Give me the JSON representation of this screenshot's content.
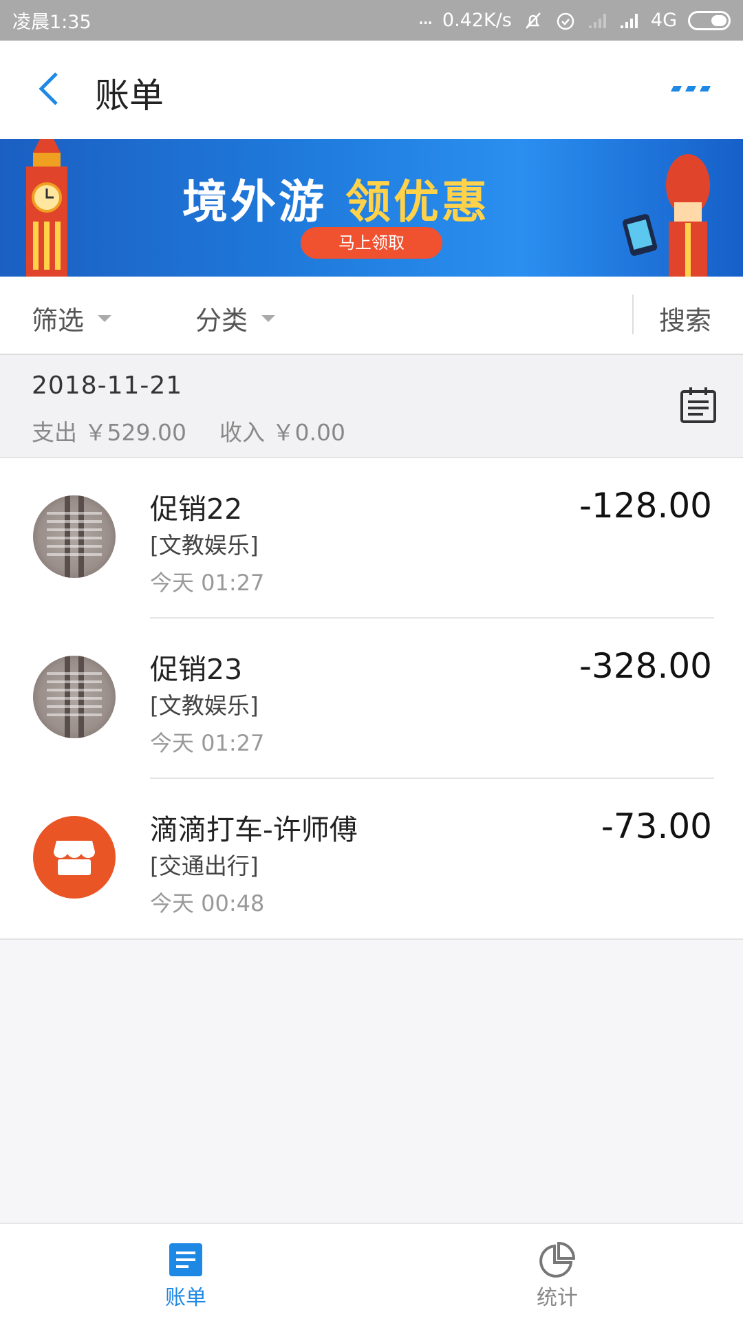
{
  "status_bar": {
    "time": "凌晨1:35",
    "dots": "...",
    "speed": "0.42K/s",
    "network": "4G"
  },
  "header": {
    "title": "账单",
    "back_icon": "chevron-left-icon",
    "more_icon": "more-dots-icon"
  },
  "banner": {
    "title_part1": "境外游",
    "title_part2": "领优惠",
    "button_label": "马上领取"
  },
  "filter": {
    "filter_label": "筛选",
    "category_label": "分类",
    "search_label": "搜索"
  },
  "summary": {
    "date": "2018-11-21",
    "expense": "支出 ￥529.00",
    "income": "收入 ￥0.00"
  },
  "transactions": [
    {
      "name": "促销22",
      "category": "[文教娱乐]",
      "time": "今天  01:27",
      "amount": "-128.00",
      "icon": "document-photo-icon"
    },
    {
      "name": "促销23",
      "category": "[文教娱乐]",
      "time": "今天  01:27",
      "amount": "-328.00",
      "icon": "document-photo-icon"
    },
    {
      "name": "滴滴打车-许师傅",
      "category": "[交通出行]",
      "time": "今天  00:48",
      "amount": "-73.00",
      "icon": "shop-icon"
    }
  ],
  "tabs": [
    {
      "label": "账单",
      "icon": "bill-list-icon",
      "active": true
    },
    {
      "label": "统计",
      "icon": "pie-chart-icon",
      "active": false
    }
  ],
  "colors": {
    "accent": "#1e88e5",
    "shop_icon_bg": "#ea5526",
    "banner_button": "#f0512f"
  }
}
